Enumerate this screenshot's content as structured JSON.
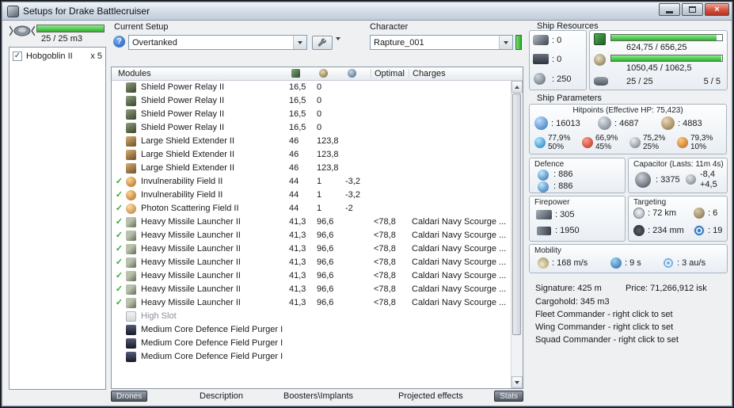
{
  "window": {
    "title": "Setups for Drake Battlecruiser"
  },
  "colors": {
    "bar_green": "#3ecb3e",
    "check_green": "#2fae2f",
    "close_red": "#c74634"
  },
  "drone_bay": {
    "capacity_label": "25 / 25 m3",
    "fill_pct": 100,
    "items": [
      {
        "name": "Hobgoblin II",
        "qty": "x 5",
        "checked": true
      }
    ]
  },
  "setup": {
    "label": "Current Setup",
    "value": "Overtanked"
  },
  "character": {
    "label": "Character",
    "value": "Rapture_001"
  },
  "modules": {
    "columns": {
      "name": "Modules",
      "optimal": "Optimal",
      "charges": "Charges"
    },
    "rows": [
      {
        "check": false,
        "icon": "shield-power-relay",
        "name": "Shield Power Relay II",
        "cpu": "16,5",
        "pg": "0",
        "cap": "",
        "optimal": "",
        "charges": ""
      },
      {
        "check": false,
        "icon": "shield-power-relay",
        "name": "Shield Power Relay II",
        "cpu": "16,5",
        "pg": "0",
        "cap": "",
        "optimal": "",
        "charges": ""
      },
      {
        "check": false,
        "icon": "shield-power-relay",
        "name": "Shield Power Relay II",
        "cpu": "16,5",
        "pg": "0",
        "cap": "",
        "optimal": "",
        "charges": ""
      },
      {
        "check": false,
        "icon": "shield-power-relay",
        "name": "Shield Power Relay II",
        "cpu": "16,5",
        "pg": "0",
        "cap": "",
        "optimal": "",
        "charges": ""
      },
      {
        "check": false,
        "icon": "large-shield-extender",
        "name": "Large Shield Extender II",
        "cpu": "46",
        "pg": "123,8",
        "cap": "",
        "optimal": "",
        "charges": ""
      },
      {
        "check": false,
        "icon": "large-shield-extender",
        "name": "Large Shield Extender II",
        "cpu": "46",
        "pg": "123,8",
        "cap": "",
        "optimal": "",
        "charges": ""
      },
      {
        "check": false,
        "icon": "large-shield-extender",
        "name": "Large Shield Extender II",
        "cpu": "46",
        "pg": "123,8",
        "cap": "",
        "optimal": "",
        "charges": ""
      },
      {
        "check": true,
        "icon": "invulnerability-field",
        "name": "Invulnerability Field II",
        "cpu": "44",
        "pg": "1",
        "cap": "-3,2",
        "optimal": "",
        "charges": ""
      },
      {
        "check": true,
        "icon": "invulnerability-field",
        "name": "Invulnerability Field II",
        "cpu": "44",
        "pg": "1",
        "cap": "-3,2",
        "optimal": "",
        "charges": ""
      },
      {
        "check": true,
        "icon": "photon-scattering-field",
        "name": "Photon Scattering Field II",
        "cpu": "44",
        "pg": "1",
        "cap": "-2",
        "optimal": "",
        "charges": ""
      },
      {
        "check": true,
        "icon": "heavy-missile-launcher",
        "name": "Heavy Missile Launcher II",
        "cpu": "41,3",
        "pg": "96,6",
        "cap": "",
        "optimal": "<78,8",
        "charges": "Caldari Navy Scourge ..."
      },
      {
        "check": true,
        "icon": "heavy-missile-launcher",
        "name": "Heavy Missile Launcher II",
        "cpu": "41,3",
        "pg": "96,6",
        "cap": "",
        "optimal": "<78,8",
        "charges": "Caldari Navy Scourge ..."
      },
      {
        "check": true,
        "icon": "heavy-missile-launcher",
        "name": "Heavy Missile Launcher II",
        "cpu": "41,3",
        "pg": "96,6",
        "cap": "",
        "optimal": "<78,8",
        "charges": "Caldari Navy Scourge ..."
      },
      {
        "check": true,
        "icon": "heavy-missile-launcher",
        "name": "Heavy Missile Launcher II",
        "cpu": "41,3",
        "pg": "96,6",
        "cap": "",
        "optimal": "<78,8",
        "charges": "Caldari Navy Scourge ..."
      },
      {
        "check": true,
        "icon": "heavy-missile-launcher",
        "name": "Heavy Missile Launcher II",
        "cpu": "41,3",
        "pg": "96,6",
        "cap": "",
        "optimal": "<78,8",
        "charges": "Caldari Navy Scourge ..."
      },
      {
        "check": true,
        "icon": "heavy-missile-launcher",
        "name": "Heavy Missile Launcher II",
        "cpu": "41,3",
        "pg": "96,6",
        "cap": "",
        "optimal": "<78,8",
        "charges": "Caldari Navy Scourge ..."
      },
      {
        "check": true,
        "icon": "heavy-missile-launcher",
        "name": "Heavy Missile Launcher II",
        "cpu": "41,3",
        "pg": "96,6",
        "cap": "",
        "optimal": "<78,8",
        "charges": "Caldari Navy Scourge ..."
      },
      {
        "check": false,
        "icon": "empty-high-slot",
        "name": "High Slot",
        "cpu": "",
        "pg": "",
        "cap": "",
        "optimal": "",
        "charges": "",
        "empty": true
      },
      {
        "check": false,
        "icon": "rig-purger",
        "name": "Medium Core Defence Field Purger I",
        "cpu": "",
        "pg": "",
        "cap": "",
        "optimal": "",
        "charges": ""
      },
      {
        "check": false,
        "icon": "rig-purger",
        "name": "Medium Core Defence Field Purger I",
        "cpu": "",
        "pg": "",
        "cap": "",
        "optimal": "",
        "charges": ""
      },
      {
        "check": false,
        "icon": "rig-purger",
        "name": "Medium Core Defence Field Purger I",
        "cpu": "",
        "pg": "",
        "cap": "",
        "optimal": "",
        "charges": ""
      }
    ]
  },
  "tabs": {
    "drones": "Drones",
    "description": "Description",
    "boosters": "Boosters\\Implants",
    "projected": "Projected effects",
    "stats": "Stats"
  },
  "ship_resources": {
    "title": "Ship Resources",
    "turrets": ": 0",
    "launchers": ": 0",
    "calibration": ": 250",
    "cpu_text": "624,75 / 656,25",
    "cpu_pct": 95,
    "pg_text": "1050,45 / 1062,5",
    "pg_pct": 99,
    "dronebay_text": "25 / 25",
    "drones_text": "5 / 5"
  },
  "ship_parameters": {
    "title": "Ship Parameters",
    "hitpoints": {
      "title": "Hitpoints (Effective HP: 75,423)",
      "shield": ": 16013",
      "armor": ": 4687",
      "hull": ": 4883",
      "resists": [
        {
          "top": "77,9%",
          "bottom": "50%"
        },
        {
          "top": "66,9%",
          "bottom": "45%"
        },
        {
          "top": "75,2%",
          "bottom": "25%"
        },
        {
          "top": "79,3%",
          "bottom": "10%"
        }
      ]
    },
    "defence": {
      "title": "Defence",
      "line1": ": 886",
      "line2": ": 886"
    },
    "capacitor": {
      "title": "Capacitor (Lasts: 11m 4s)",
      "amount": ": 3375",
      "delta_neg": "-8,4",
      "delta_pos": "+4,5"
    },
    "firepower": {
      "title": "Firepower",
      "volley": ": 305",
      "dps": ": 1950"
    },
    "targeting": {
      "title": "Targeting",
      "range": ": 72 km",
      "max_targets": ": 6",
      "scan_res": ": 234 mm",
      "sensor_strength": ": 19"
    },
    "mobility": {
      "title": "Mobility",
      "speed": ": 168 m/s",
      "align": ": 9 s",
      "warp": ": 3 au/s"
    },
    "signature": "Signature: 425 m",
    "price": "Price: 71,266,912 isk",
    "cargohold": "Cargohold: 345 m3",
    "fleet_commander": "Fleet Commander - right click to set",
    "wing_commander": "Wing Commander - right click to set",
    "squad_commander": "Squad Commander - right click to set"
  }
}
